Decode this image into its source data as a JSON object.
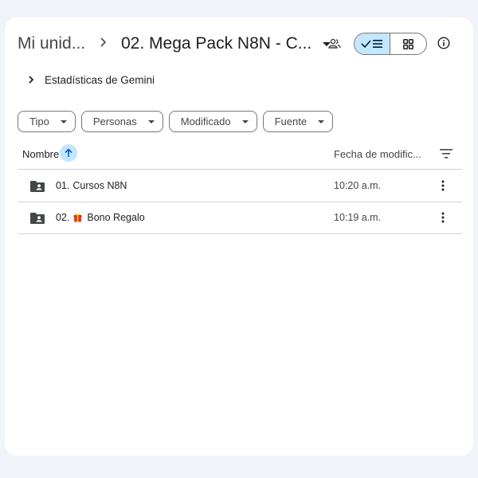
{
  "breadcrumb": {
    "root": "Mi unid...",
    "current": "02. Mega Pack N8N - C..."
  },
  "gemini": {
    "label": "Estadísticas de Gemini"
  },
  "filters": [
    {
      "label": "Tipo"
    },
    {
      "label": "Personas"
    },
    {
      "label": "Modificado"
    },
    {
      "label": "Fuente"
    }
  ],
  "table": {
    "columns": {
      "name": "Nombre",
      "modified": "Fecha de modific..."
    },
    "rows": [
      {
        "prefix": "01.",
        "name": "Cursos N8N",
        "has_gift_icon": false,
        "modified": "10:20 a.m."
      },
      {
        "prefix": "02.",
        "name": "Bono Regalo",
        "has_gift_icon": true,
        "modified": "10:19 a.m."
      }
    ]
  },
  "colors": {
    "accent_light": "#c2e7ff",
    "text_primary": "#1f1f1f",
    "text_secondary": "#444746",
    "background": "#f0f4f9",
    "gift_red": "#d93025",
    "gift_yellow": "#fbbc04"
  },
  "icons": {
    "breadcrumb_separator": "chevron-right-icon",
    "share": "people-icon",
    "list_view": "check-list-icon",
    "grid_view": "grid-icon",
    "info": "info-icon",
    "folder": "shared-folder-icon",
    "gift": "gift-emoji",
    "more": "more-vertical-icon"
  }
}
